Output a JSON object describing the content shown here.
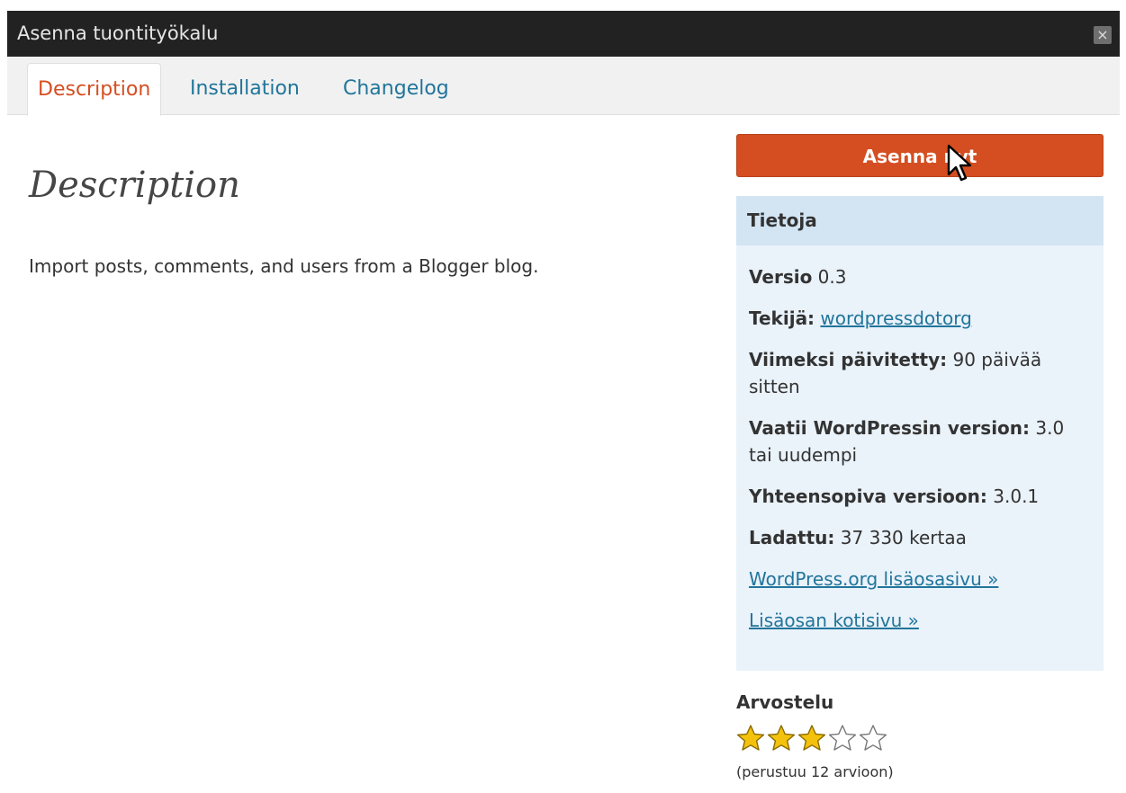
{
  "dialog": {
    "title": "Asenna tuontityökalu",
    "close_symbol": "×"
  },
  "tabs": [
    {
      "label": "Description",
      "active": true
    },
    {
      "label": "Installation",
      "active": false
    },
    {
      "label": "Changelog",
      "active": false
    }
  ],
  "main": {
    "heading": "Description",
    "text": "Import posts, comments, and users from a Blogger blog."
  },
  "sidebar": {
    "install_label": "Asenna nyt",
    "info_title": "Tietoja",
    "version_label": "Versio",
    "version_value": "0.3",
    "author_label": "Tekijä:",
    "author_value": "wordpressdotorg",
    "updated_label": "Viimeksi päivitetty:",
    "updated_value": "90 päivää sitten",
    "requires_label": "Vaatii WordPressin version:",
    "requires_value": "3.0 tai uudempi",
    "compatible_label": "Yhteensopiva versioon:",
    "compatible_value": "3.0.1",
    "downloaded_label": "Ladattu:",
    "downloaded_value": "37 330 kertaa",
    "link_plugin_page": "WordPress.org lisäosasivu »",
    "link_homepage": "Lisäosan kotisivu »"
  },
  "rating": {
    "title": "Arvostelu",
    "stars": 3,
    "max_stars": 5,
    "note": "(perustuu 12 arvioon)"
  },
  "colors": {
    "accent": "#d54e21",
    "link": "#21759b",
    "titlebar": "#222222",
    "info_bg": "#eaf2fa",
    "info_header_bg": "#d3e5f3",
    "star_fill": "#f4c20d"
  },
  "icons": {
    "close": "close-icon",
    "cursor": "mouse-pointer-icon",
    "star_filled": "star-filled-icon",
    "star_empty": "star-empty-icon"
  }
}
